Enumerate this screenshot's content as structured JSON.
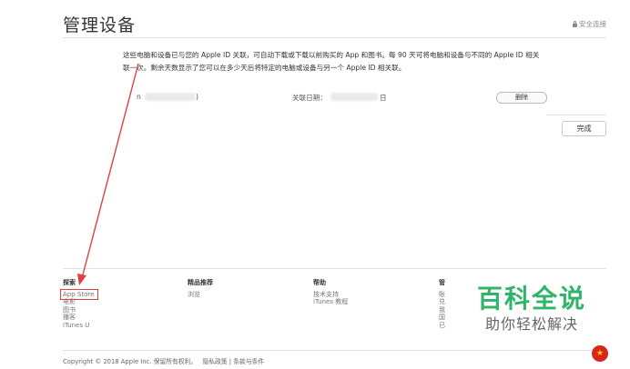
{
  "page": {
    "title": "管理设备",
    "secure_label": "安全连接"
  },
  "notice": {
    "text": "这些电脑和设备已与您的 Apple ID 关联，可自动下载或下载以前购买的 App 和图书。每 90 天可将电脑和设备与不同的 Apple ID 相关联一次。剩余天数显示了您可以在多少天后将特定的电脑或设备与另一个 Apple ID 相关联。"
  },
  "device": {
    "name_prefix": "n",
    "name_suffix": ")",
    "date_label": "关联日期：",
    "date_suffix": "日",
    "remove_label": "删除"
  },
  "done_label": "完成",
  "footer": {
    "columns": [
      {
        "heading": "探索",
        "links": [
          "App Store",
          "电影",
          "图书",
          "播客",
          "iTunes U"
        ]
      },
      {
        "heading": "精品推荐",
        "links": [
          "浏览"
        ]
      },
      {
        "heading": "帮助",
        "links": [
          "技术支持",
          "iTunes 教程"
        ]
      },
      {
        "heading": "管",
        "links": [
          "账",
          "兑",
          "我",
          "国",
          "已"
        ]
      }
    ],
    "copyright": "Copyright © 2018 Apple Inc. 保留所有权利。",
    "privacy": "隐私政策",
    "terms": "条款与条件",
    "separator": "|"
  },
  "watermark": {
    "title": "百科全说",
    "subtitle": "助你轻松解决"
  },
  "colors": {
    "highlight": "#e04040",
    "watermark": "#2fb46a"
  }
}
